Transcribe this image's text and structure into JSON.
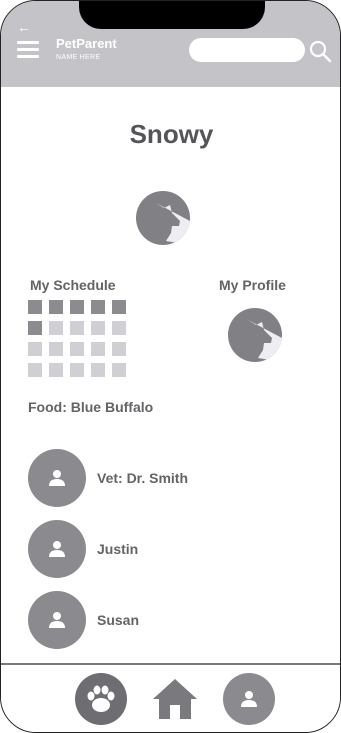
{
  "header": {
    "brand": "PetParent",
    "subtitle": "NAME HERE",
    "search_placeholder": ""
  },
  "pet": {
    "name": "Snowy"
  },
  "schedule": {
    "label": "My Schedule",
    "rows": 4,
    "cols": 5,
    "active_cells": [
      0,
      1,
      2,
      3,
      4,
      5
    ],
    "colors": {
      "active": "#8b8b90",
      "inactive": "#d0d0d4"
    }
  },
  "profile": {
    "label": "My Profile"
  },
  "food": {
    "text": "Food: Blue Buffalo"
  },
  "contacts": [
    {
      "name": "Vet: Dr. Smith"
    },
    {
      "name": "Justin"
    },
    {
      "name": "Susan"
    }
  ],
  "colors": {
    "header_bg": "#c4c4c8",
    "avatar": "#808085",
    "text": "#646468"
  },
  "nav": {
    "items": [
      "paw-icon",
      "home-icon",
      "user-icon"
    ]
  }
}
